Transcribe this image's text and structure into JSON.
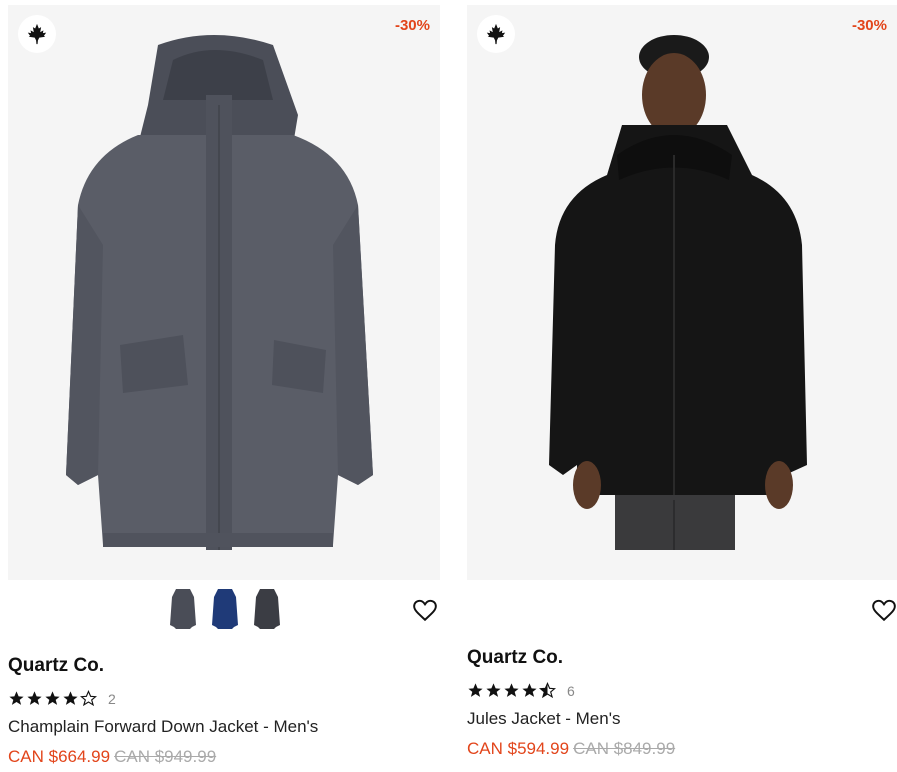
{
  "products": [
    {
      "discount": "-30%",
      "brand": "Quartz Co.",
      "rating": 4,
      "rating_count": "2",
      "name": "Champlain Forward Down Jacket - Men's",
      "sale_price": "CAN $664.99",
      "original_price": "CAN $949.99",
      "image": "grey-parka-jacket",
      "swatches": [
        "#4a4d57",
        "#1f3a78",
        "#3b3d44"
      ]
    },
    {
      "discount": "-30%",
      "brand": "Quartz Co.",
      "rating": 4.5,
      "rating_count": "6",
      "name": "Jules Jacket - Men's",
      "sale_price": "CAN $594.99",
      "original_price": "CAN $849.99",
      "image": "man-in-black-jacket"
    }
  ],
  "colors": {
    "accent": "#e2451b",
    "muted": "#aaaaaa",
    "image_bg": "#f5f5f5"
  }
}
